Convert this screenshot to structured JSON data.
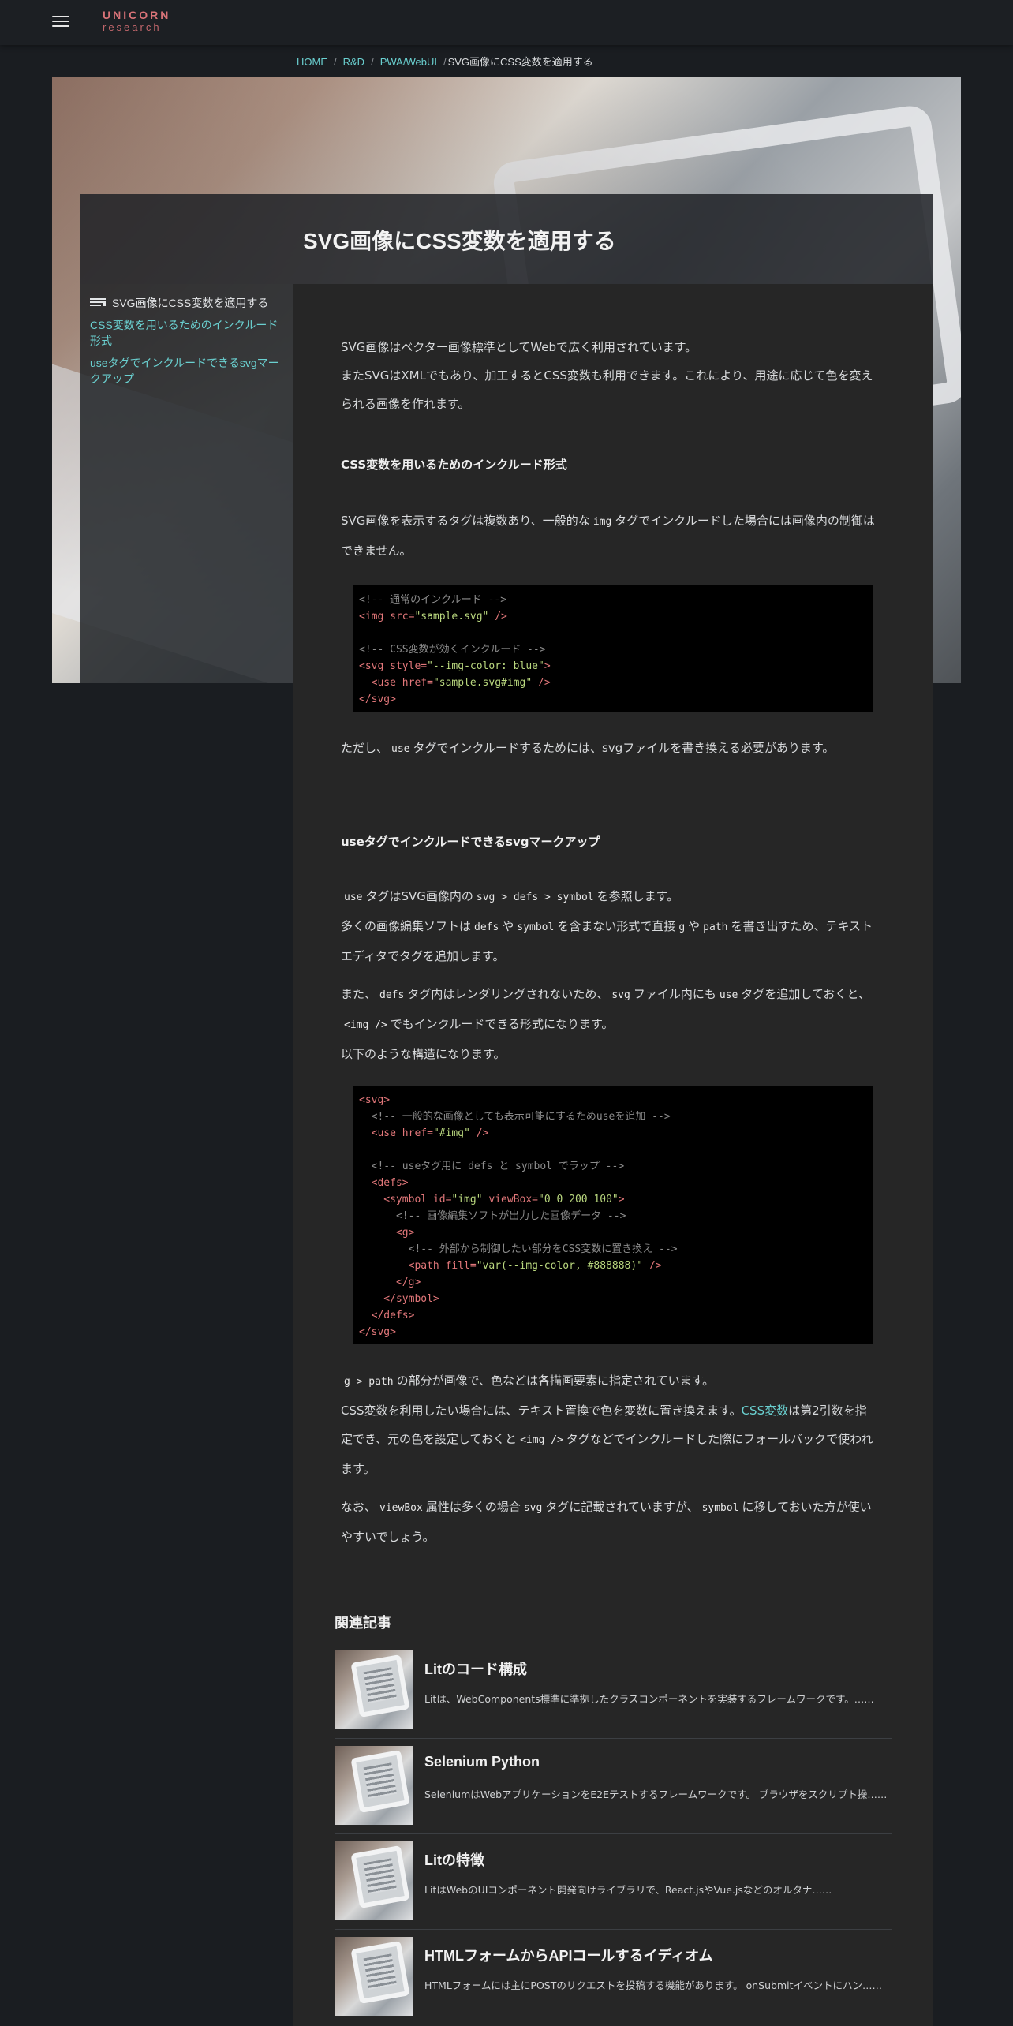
{
  "header": {
    "logo_line1": "UNICORN",
    "logo_line2": "research",
    "menu_icon": "hamburger-menu-icon"
  },
  "breadcrumb": {
    "items": [
      "HOME",
      "R&D",
      "PWA/WebUI"
    ],
    "separator": "/",
    "current": "SVG画像にCSS変数を適用する"
  },
  "page_title": "SVG画像にCSS変数を適用する",
  "toc": {
    "heading": "SVG画像にCSS変数を適用する",
    "icon": "toc-list-icon",
    "items": [
      "CSS変数を用いるためのインクルード形式",
      "useタグでインクルードできるsvgマークアップ"
    ]
  },
  "article": {
    "intro_1": "SVG画像はベクター画像標準としてWebで広く利用されています。",
    "intro_2": "またSVGはXMLでもあり、加工するとCSS変数も利用できます。これにより、用途に応じて色を変えられる画像を作れます。",
    "section1_title": "CSS変数を用いるためのインクルード形式",
    "s1_p1_a": "SVG画像を表示するタグは複数あり、一般的な",
    "s1_p1_code": "img",
    "s1_p1_b": "タグでインクルードした場合には画像内の制御はできません。",
    "code1": {
      "l1": "<!-- 通常のインクルード -->",
      "l2_tag": "<img",
      "l2_attr": " src=",
      "l2_str": "\"sample.svg\"",
      "l2_end": " />",
      "l4": "<!-- CSS変数が効くインクルード -->",
      "l5_tag": "<svg",
      "l5_attr": " style=",
      "l5_str": "\"--img-color: blue\"",
      "l5_end": ">",
      "l6_tag": "  <use",
      "l6_attr": " href=",
      "l6_str": "\"sample.svg#img\"",
      "l6_end": " />",
      "l7": "</svg>"
    },
    "s1_p2_a": "ただし、",
    "s1_p2_code": "use",
    "s1_p2_b": "タグでインクルードするためには、svgファイルを書き換える必要があります。",
    "section2_title": "useタグでインクルードできるsvgマークアップ",
    "s2_p1_code1": "use",
    "s2_p1_a": "タグはSVG画像内の",
    "s2_p1_code2": "svg > defs > symbol",
    "s2_p1_b": "を参照します。",
    "s2_p2_a": "多くの画像編集ソフトは",
    "s2_p2_code1": "defs",
    "s2_p2_b": "や",
    "s2_p2_code2": "symbol",
    "s2_p2_c": "を含まない形式で直接",
    "s2_p2_code3": "g",
    "s2_p2_d": "や",
    "s2_p2_code4": "path",
    "s2_p2_e": "を書き出すため、テキストエディタでタグを追加します。",
    "s2_p3_a": "また、",
    "s2_p3_code1": "defs",
    "s2_p3_b": "タグ内はレンダリングされないため、",
    "s2_p3_code2": "svg",
    "s2_p3_c": "ファイル内にも",
    "s2_p3_code3": "use",
    "s2_p3_d": "タグを追加しておくと、",
    "s2_p3_code4": "<img />",
    "s2_p3_e": "でもインクルードできる形式になります。",
    "s2_p4": "以下のような構造になります。",
    "code2": {
      "l1": "<svg>",
      "l2": "  <!-- 一般的な画像としても表示可能にするためuseを追加 -->",
      "l3_tag": "  <use",
      "l3_attr": " href=",
      "l3_str": "\"#img\"",
      "l3_end": " />",
      "l5": "  <!-- useタグ用に defs と symbol でラップ -->",
      "l6": "  <defs>",
      "l7_tag": "    <symbol",
      "l7_attr1": " id=",
      "l7_str1": "\"img\"",
      "l7_attr2": " viewBox=",
      "l7_str2": "\"0 0 200 100\"",
      "l7_end": ">",
      "l8": "      <!-- 画像編集ソフトが出力した画像データ -->",
      "l9": "      <g>",
      "l10": "        <!-- 外部から制御したい部分をCSS変数に置き換え -->",
      "l11_tag": "        <path",
      "l11_attr": " fill=",
      "l11_str": "\"var(--img-color, #888888)\"",
      "l11_end": " />",
      "l12": "      </g>",
      "l13": "    </symbol>",
      "l14": "  </defs>",
      "l15": "</svg>"
    },
    "s2_p5_code": "g > path",
    "s2_p5_a": "の部分が画像で、色などは各描画要素に指定されています。",
    "s2_p6_a": "CSS変数を利用したい場合には、テキスト置換で色を変数に置き換えます。",
    "s2_p6_link": "CSS変数",
    "s2_p6_b": "は第2引数を指定でき、元の色を設定しておくと",
    "s2_p6_code": "<img />",
    "s2_p6_c": "タグなどでインクルードした際にフォールバックで使われます。",
    "s2_p7_a": "なお、",
    "s2_p7_code1": "viewBox",
    "s2_p7_b": "属性は多くの場合",
    "s2_p7_code2": "svg",
    "s2_p7_c": "タグに記載されていますが、",
    "s2_p7_code3": "symbol",
    "s2_p7_d": "に移しておいた方が使いやすいでしょう。"
  },
  "related": {
    "heading": "関連記事",
    "items": [
      {
        "title": "Litのコード構成",
        "desc": "Litは、WebComponents標準に準拠したクラスコンポーネントを実装するフレームワークです。……"
      },
      {
        "title": "Selenium Python",
        "desc": "SeleniumはWebアプリケーションをE2Eテストするフレームワークです。 ブラウザをスクリプト操……"
      },
      {
        "title": "Litの特徴",
        "desc": "LitはWebのUIコンポーネント開発向けライブラリで、React.jsやVue.jsなどのオルタナ……"
      },
      {
        "title": "HTMLフォームからAPIコールするイディオム",
        "desc": "HTMLフォームには主にPOSTのリクエストを投稿する機能があります。 onSubmitイベントにハン……"
      }
    ]
  }
}
